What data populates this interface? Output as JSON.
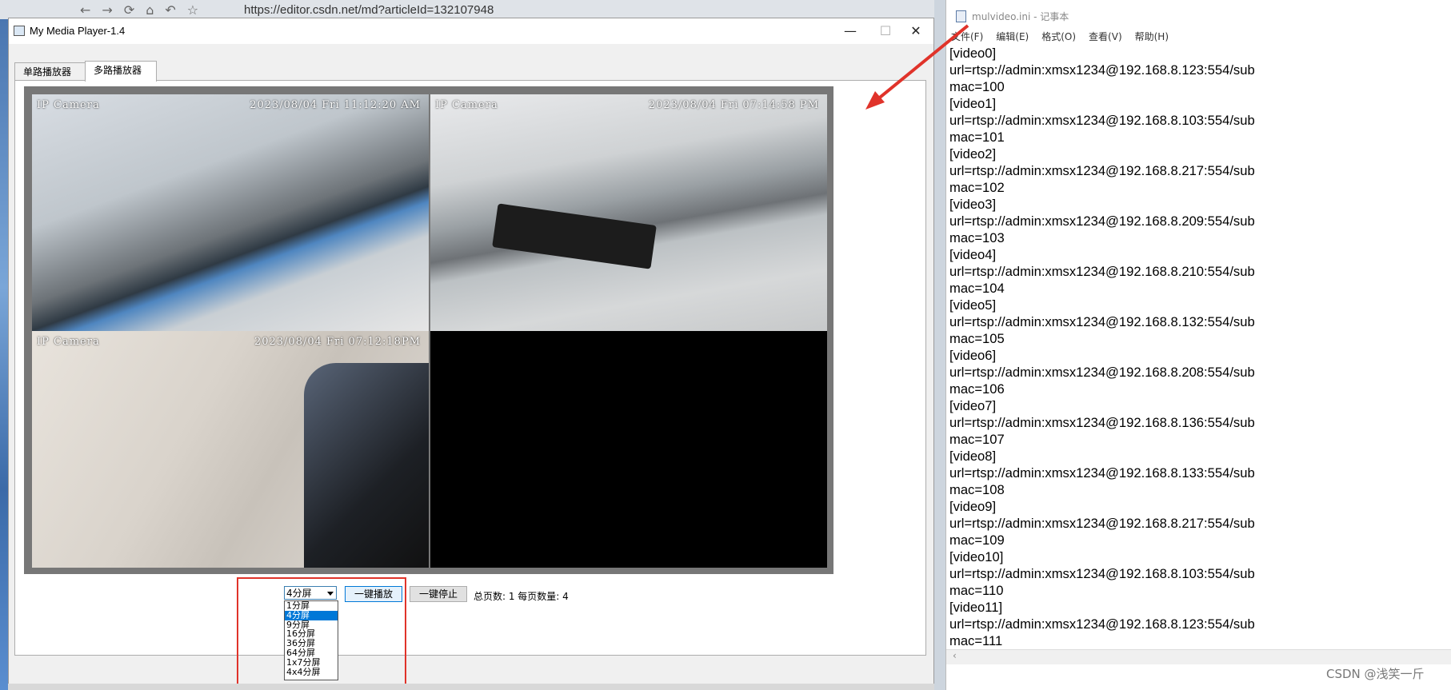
{
  "browser": {
    "url": "https://editor.csdn.net/md?articleId=132107948"
  },
  "player": {
    "title": "My Media Player-1.4",
    "tabs": [
      "单路播放器",
      "多路播放器"
    ],
    "cells": [
      {
        "osd_left": "IP Camera",
        "osd_right": "2023/08/04 Fri 11:12:20 AM"
      },
      {
        "osd_left": "IP Camera",
        "osd_right": "2023/08/04 Fri 07:14:58 PM"
      },
      {
        "osd_left": "IP Camera",
        "osd_right": "2023/08/04 Fri 07:12:18PM"
      },
      {
        "osd_left": "",
        "osd_right": ""
      }
    ],
    "layout_select": {
      "value": "4分屏",
      "options": [
        "1分屏",
        "4分屏",
        "9分屏",
        "16分屏",
        "36分屏",
        "64分屏",
        "1x7分屏",
        "4x4分屏"
      ],
      "selected_index": 1
    },
    "play_all": "一键播放",
    "stop_all": "一键停止",
    "page_info": "总页数: 1 每页数量: 4"
  },
  "notepad": {
    "title": "mulvideo.ini - 记事本",
    "menu": [
      "文件(F)",
      "编辑(E)",
      "格式(O)",
      "查看(V)",
      "帮助(H)"
    ],
    "lines": [
      "[video0]",
      "url=rtsp://admin:xmsx1234@192.168.8.123:554/sub",
      "mac=100",
      "[video1]",
      "url=rtsp://admin:xmsx1234@192.168.8.103:554/sub",
      "mac=101",
      "[video2]",
      "url=rtsp://admin:xmsx1234@192.168.8.217:554/sub",
      "mac=102",
      "[video3]",
      "url=rtsp://admin:xmsx1234@192.168.8.209:554/sub",
      "mac=103",
      "[video4]",
      "url=rtsp://admin:xmsx1234@192.168.8.210:554/sub",
      "mac=104",
      "[video5]",
      "url=rtsp://admin:xmsx1234@192.168.8.132:554/sub",
      "mac=105",
      "[video6]",
      "url=rtsp://admin:xmsx1234@192.168.8.208:554/sub",
      "mac=106",
      "[video7]",
      "url=rtsp://admin:xmsx1234@192.168.8.136:554/sub",
      "mac=107",
      "[video8]",
      "url=rtsp://admin:xmsx1234@192.168.8.133:554/sub",
      "mac=108",
      "[video9]",
      "url=rtsp://admin:xmsx1234@192.168.8.217:554/sub",
      "mac=109",
      "[video10]",
      "url=rtsp://admin:xmsx1234@192.168.8.103:554/sub",
      "mac=110",
      "[video11]",
      "url=rtsp://admin:xmsx1234@192.168.8.123:554/sub",
      "mac=111"
    ]
  },
  "watermark": "CSDN @浅笑一斤",
  "colors": {
    "annotation_red": "#e0332a",
    "selection_blue": "#0078d7"
  }
}
